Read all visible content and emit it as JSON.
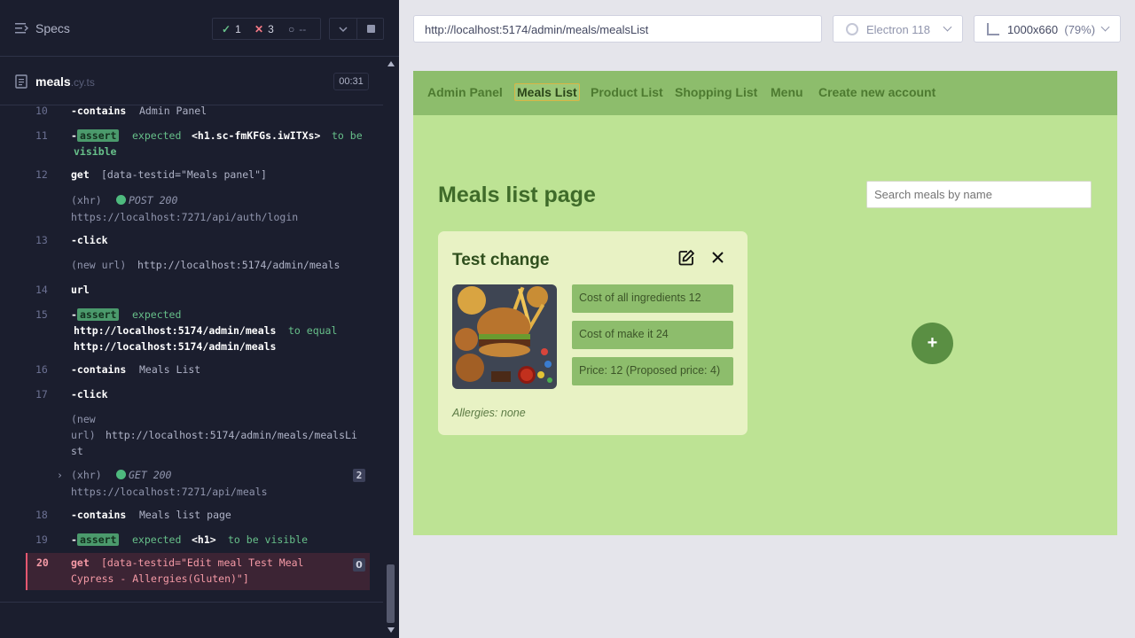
{
  "reporter": {
    "specs_title": "Specs",
    "stats": {
      "passed": "1",
      "failed": "3",
      "pending": "--"
    },
    "file": {
      "name": "meals",
      "ext": ".cy.ts",
      "duration": "00:31"
    },
    "log": [
      {
        "num": "10",
        "cmd": "-contains",
        "arg": "Admin Panel"
      },
      {
        "num": "11",
        "cmd": "-assert",
        "line1": "expected",
        "code": "<h1.sc-fmKFGs.iwITXs>",
        "tail": "to be",
        "line2": "visible"
      },
      {
        "num": "12",
        "cmd": "get",
        "arg": "[data-testid=\"Meals panel\"]"
      },
      {
        "xhr": "(xhr)",
        "method": "POST 200",
        "url": "https://localhost:7271/api/auth/login"
      },
      {
        "num": "13",
        "cmd": "-click"
      },
      {
        "label": "(new url)",
        "url": "http://localhost:5174/admin/meals"
      },
      {
        "num": "14",
        "cmd": "url"
      },
      {
        "num": "15",
        "cmd": "-assert",
        "line1": "expected",
        "code1": "http://localhost:5174/admin/meals",
        "tail": "to equal",
        "code2": "http://localhost:5174/admin/meals"
      },
      {
        "num": "16",
        "cmd": "-contains",
        "arg": "Meals List"
      },
      {
        "num": "17",
        "cmd": "-click"
      },
      {
        "label1": "(new",
        "label2": "url)",
        "url1": "http://localhost:5174/admin/meals/mealsLi",
        "url2": "st"
      },
      {
        "xhr": "(xhr)",
        "method": "GET 200",
        "url": "https://localhost:7271/api/meals",
        "count": "2"
      },
      {
        "num": "18",
        "cmd": "-contains",
        "arg": "Meals list page"
      },
      {
        "num": "19",
        "cmd": "-assert",
        "line1": "expected",
        "code": "<h1>",
        "tail": "to be visible"
      },
      {
        "num": "20",
        "cmd": "get",
        "line1": "[data-testid=\"Edit meal Test Meal",
        "line2": "Cypress - Allergies(Gluten)\"]",
        "count": "0"
      }
    ]
  },
  "browser": {
    "url": "http://localhost:5174/admin/meals/mealsList",
    "name": "Electron 118",
    "viewport": "1000x660",
    "zoom": "(79%)"
  },
  "app": {
    "nav": [
      "Admin Panel",
      "Meals List",
      "Product List",
      "Shopping List",
      "Menu",
      "Create new account"
    ],
    "page_title": "Meals list page",
    "search_placeholder": "Search meals by name",
    "card": {
      "title": "Test change",
      "cost_ingredients": "Cost of all ingredients 12",
      "cost_make": "Cost of make it 24",
      "price": "Price: 12 (Proposed price: 4)",
      "allergies": "Allergies: none"
    },
    "add_label": "+"
  },
  "colors": {
    "accent_green": "#8dbd6c",
    "app_bg": "#bde394",
    "card_bg": "#e8f2c4",
    "error_red": "#e45770"
  }
}
